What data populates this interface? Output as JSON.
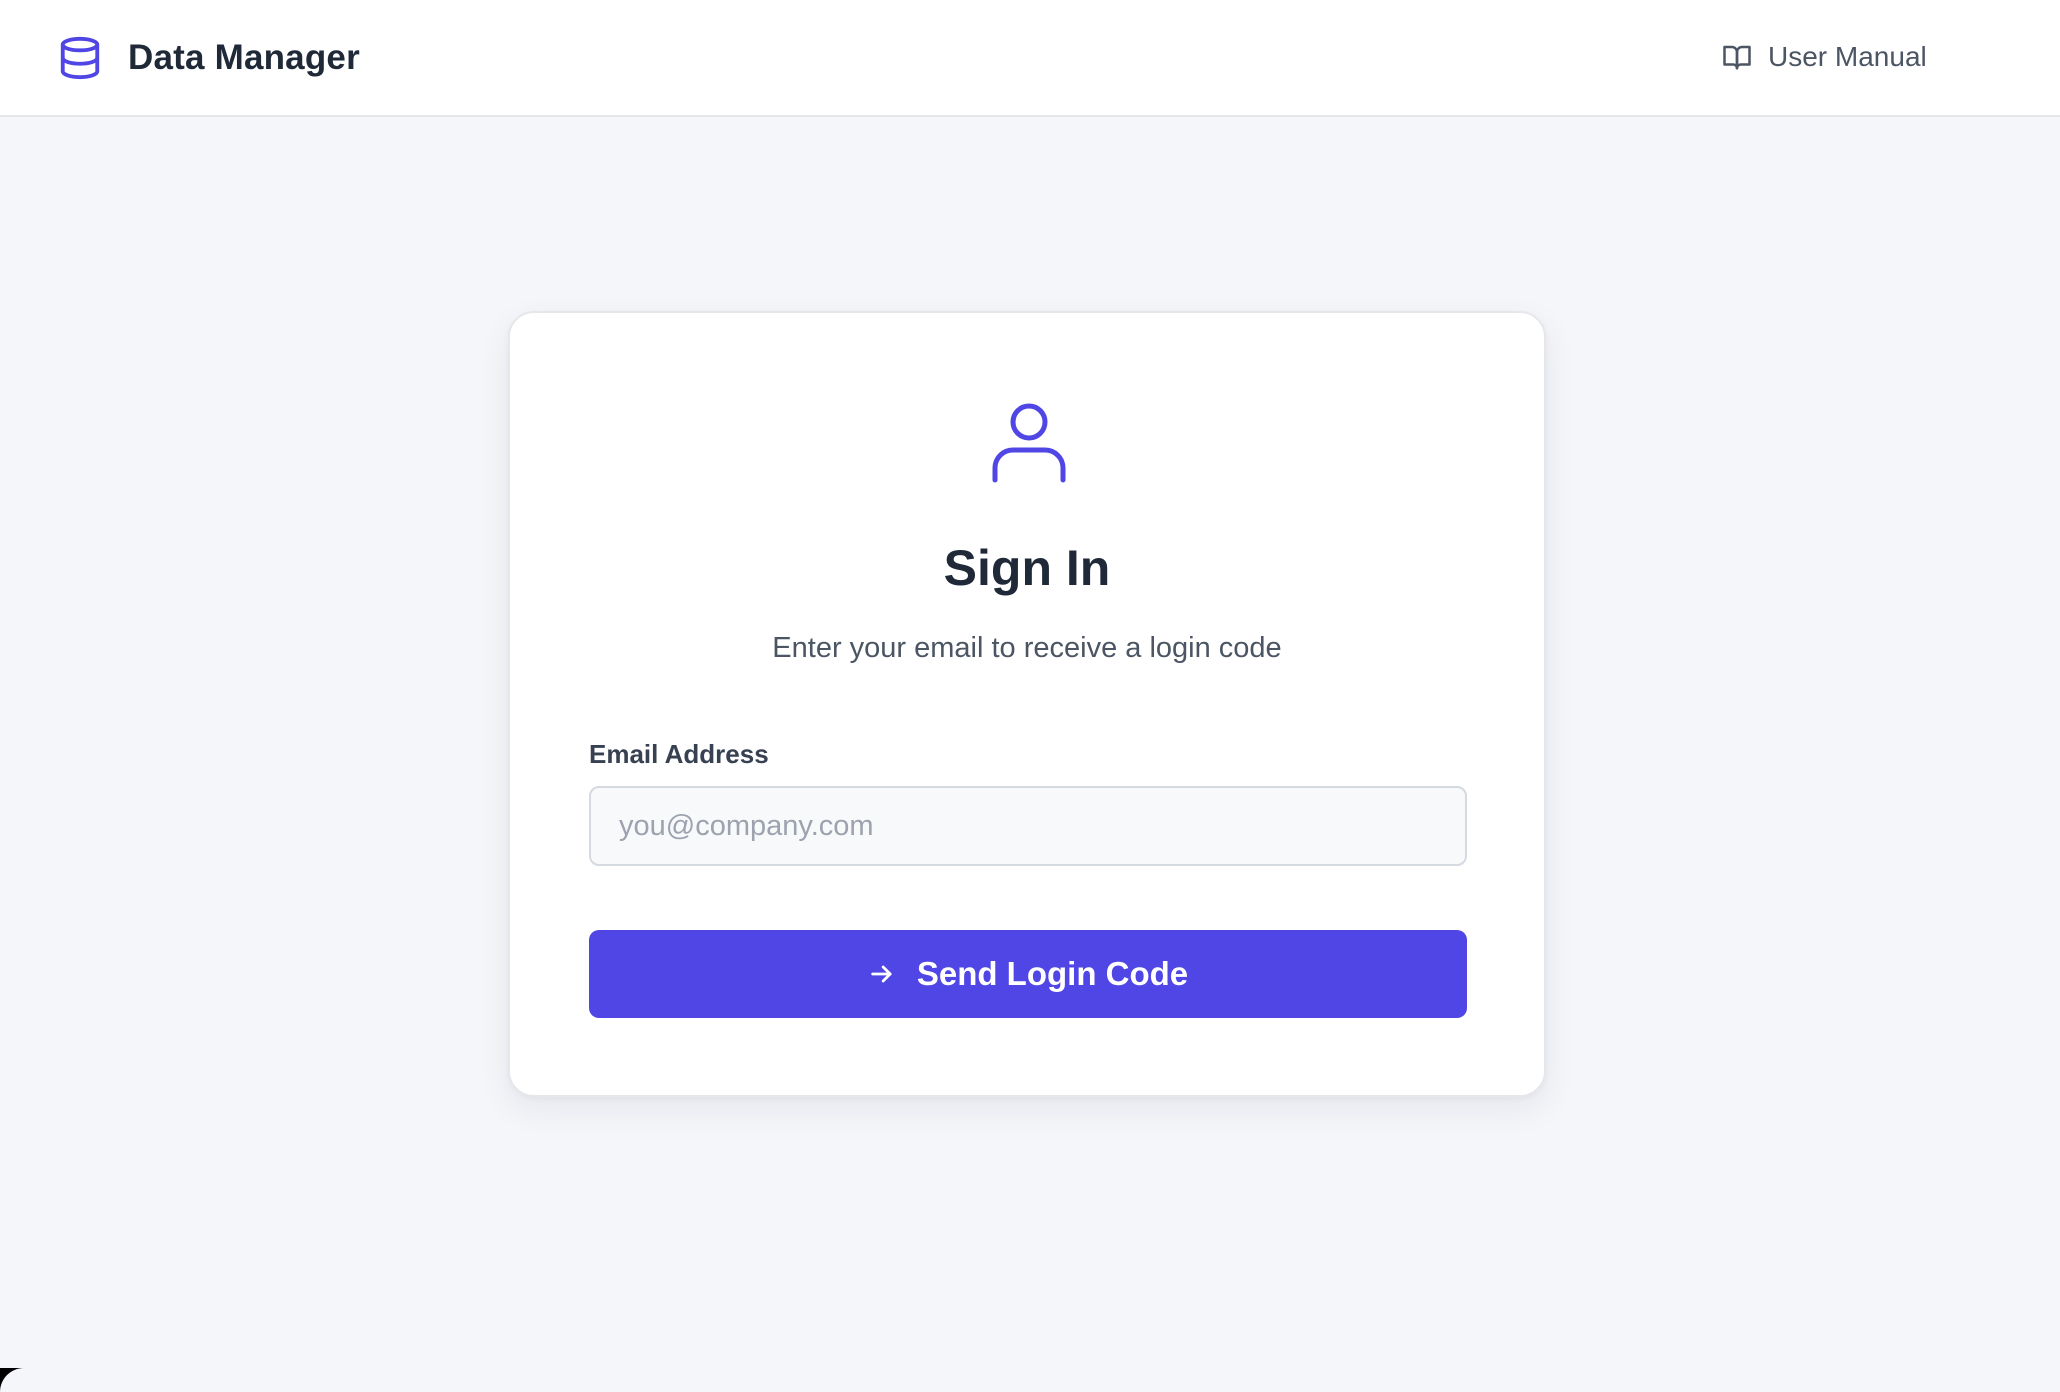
{
  "header": {
    "app_title": "Data Manager",
    "app_icon": "database-icon",
    "manual_label": "User Manual",
    "manual_icon": "book-open-icon"
  },
  "login": {
    "icon": "user-icon",
    "title": "Sign In",
    "subtitle": "Enter your email to receive a login code",
    "email_label": "Email Address",
    "email_value": "",
    "email_placeholder": "you@company.com",
    "submit_label": "Send Login Code",
    "submit_icon": "arrow-right-icon"
  },
  "colors": {
    "accent": "#4f46e5",
    "page_background": "#f5f6fa",
    "heading_text": "#1f2937",
    "muted_text": "#4b5563"
  }
}
